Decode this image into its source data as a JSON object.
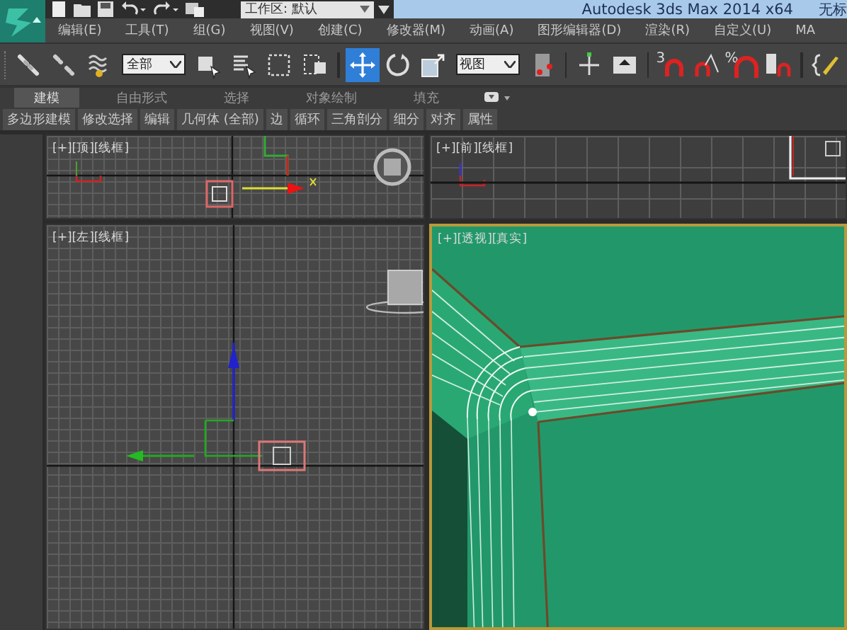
{
  "title_bar": {
    "workspace": "工作区: 默认",
    "title": "Autodesk 3ds Max  2014 x64",
    "file": "无标"
  },
  "menu": [
    "编辑(E)",
    "工具(T)",
    "组(G)",
    "视图(V)",
    "创建(C)",
    "修改器(M)",
    "动画(A)",
    "图形编辑器(D)",
    "渲染(R)",
    "自定义(U)",
    "MA"
  ],
  "toolbar": {
    "items": [
      {
        "kind": "button",
        "selected": false
      },
      {
        "kind": "button",
        "selected": false
      },
      {
        "kind": "button",
        "selected": false
      },
      {
        "kind": "dropdown",
        "value": "全部"
      },
      {
        "kind": "button",
        "selected": false
      },
      {
        "kind": "button",
        "selected": false
      },
      {
        "kind": "button",
        "selected": false
      },
      {
        "kind": "button",
        "selected": false
      },
      {
        "kind": "separator"
      },
      {
        "kind": "button",
        "selected": true
      },
      {
        "kind": "button",
        "selected": false
      },
      {
        "kind": "button",
        "selected": false
      },
      {
        "kind": "dropdown",
        "value": "视图"
      },
      {
        "kind": "button",
        "selected": false
      },
      {
        "kind": "separator"
      },
      {
        "kind": "button",
        "selected": false
      },
      {
        "kind": "button",
        "selected": false
      },
      {
        "kind": "separator"
      },
      {
        "kind": "button",
        "selected": false,
        "label": "3"
      },
      {
        "kind": "button",
        "selected": false
      },
      {
        "kind": "button",
        "selected": false,
        "label": "%"
      },
      {
        "kind": "button",
        "selected": false
      },
      {
        "kind": "separator"
      },
      {
        "kind": "button",
        "selected": false
      }
    ]
  },
  "ribbon": {
    "tabs": [
      {
        "label": "建模",
        "selected": true
      },
      {
        "label": "自由形式",
        "selected": false
      },
      {
        "label": "选择",
        "selected": false
      },
      {
        "label": "对象绘制",
        "selected": false
      },
      {
        "label": "填充",
        "selected": false
      }
    ],
    "panels": [
      "多边形建模",
      "修改选择",
      "编辑",
      "几何体 (全部)",
      "边",
      "循环",
      "三角剖分",
      "细分",
      "对齐",
      "属性"
    ]
  },
  "viewports": [
    {
      "kind": "top",
      "label": "[+][顶][线框]",
      "active": false
    },
    {
      "kind": "front",
      "label": "[+][前][线框]",
      "active": false
    },
    {
      "kind": "left",
      "label": "[+][左][线框]",
      "active": false
    },
    {
      "kind": "perspective",
      "label": "[+][透视][真实]",
      "active": true
    }
  ]
}
